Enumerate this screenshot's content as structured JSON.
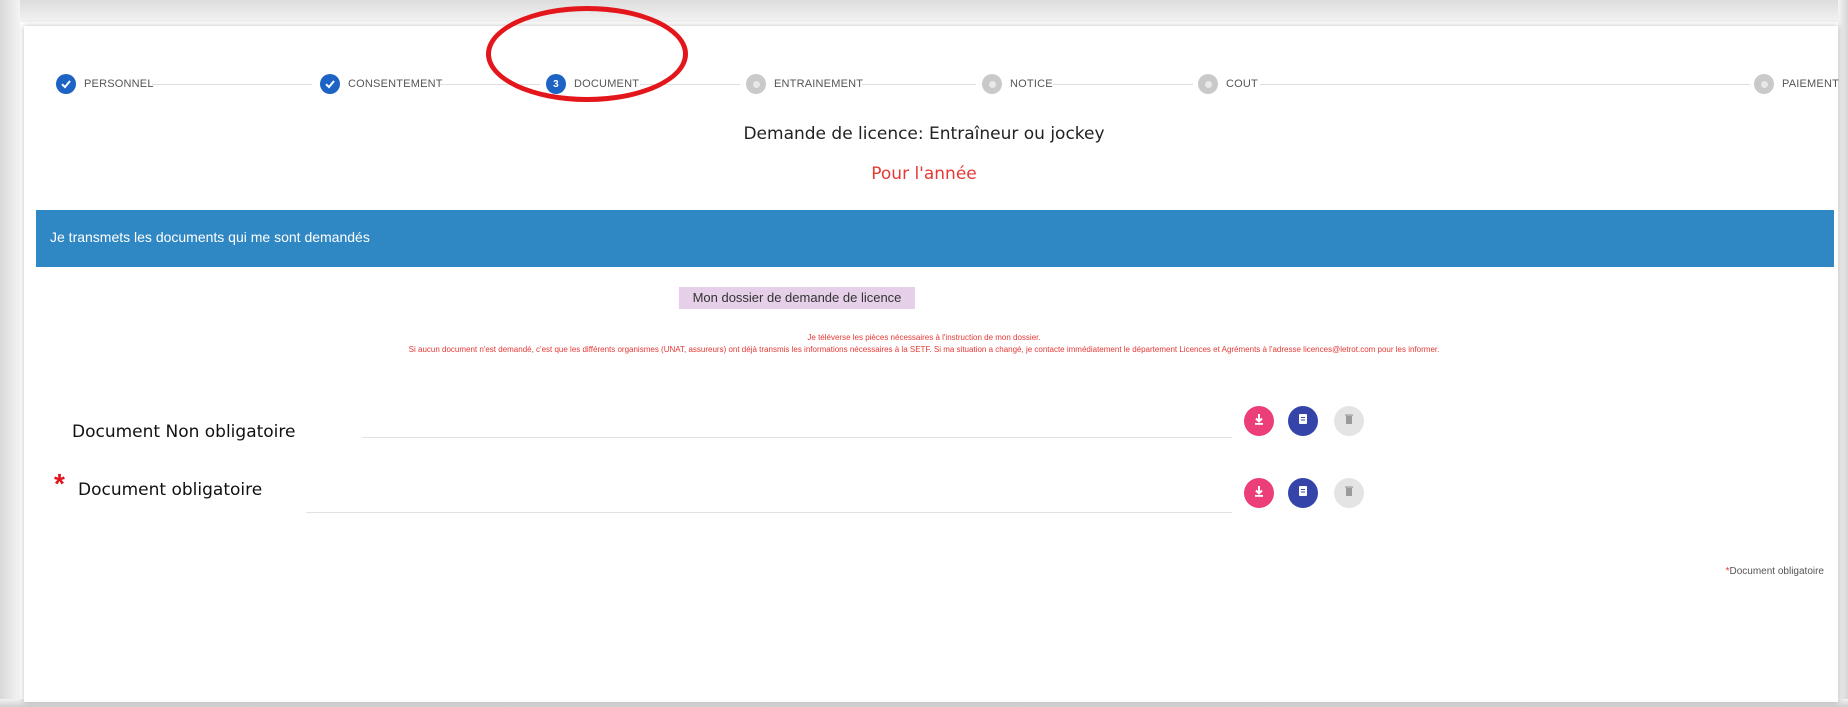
{
  "stepper": {
    "steps": [
      {
        "label": "PERSONNEL",
        "state": "done"
      },
      {
        "label": "CONSENTEMENT",
        "state": "done"
      },
      {
        "label": "DOCUMENT",
        "state": "active",
        "number": "3"
      },
      {
        "label": "ENTRAINEMENT",
        "state": "pending"
      },
      {
        "label": "NOTICE",
        "state": "pending"
      },
      {
        "label": "COUT",
        "state": "pending"
      },
      {
        "label": "PAIEMENT",
        "state": "pending"
      }
    ]
  },
  "header": {
    "form_title": "Demande de licence: Entraîneur ou jockey",
    "year_label": "Pour l'année"
  },
  "banner": {
    "text": "Je transmets les documents qui me sont demandés"
  },
  "dossier": {
    "title": "Mon dossier de demande de licence",
    "info_line1": "Je téléverse les pièces nécessaires à l'instruction de mon dossier.",
    "info_line2": "Si aucun document n'est demandé, c'est que les différents organismes (UNAT, assureurs) ont déjà transmis les informations nécessaires à la SETF. Si ma situation a changé, je contacte immédiatement le département Licences et Agréments à l'adresse licences@letrot.com pour les informer."
  },
  "documents": [
    {
      "label": "Document Non obligatoire",
      "required": false
    },
    {
      "label": "Document obligatoire",
      "required": true,
      "marker": "*"
    }
  ],
  "footer": {
    "star": "*",
    "note": "Document obligatoire"
  },
  "colors": {
    "primary": "#1c63c4",
    "banner": "#2f87c4",
    "upload": "#ec3f7a",
    "view": "#3544a8",
    "alert": "#e53935",
    "annotation": "#e3161b"
  },
  "icons": {
    "done": "check-icon",
    "upload": "download-arrow-icon",
    "view": "document-icon",
    "delete": "trash-icon"
  }
}
